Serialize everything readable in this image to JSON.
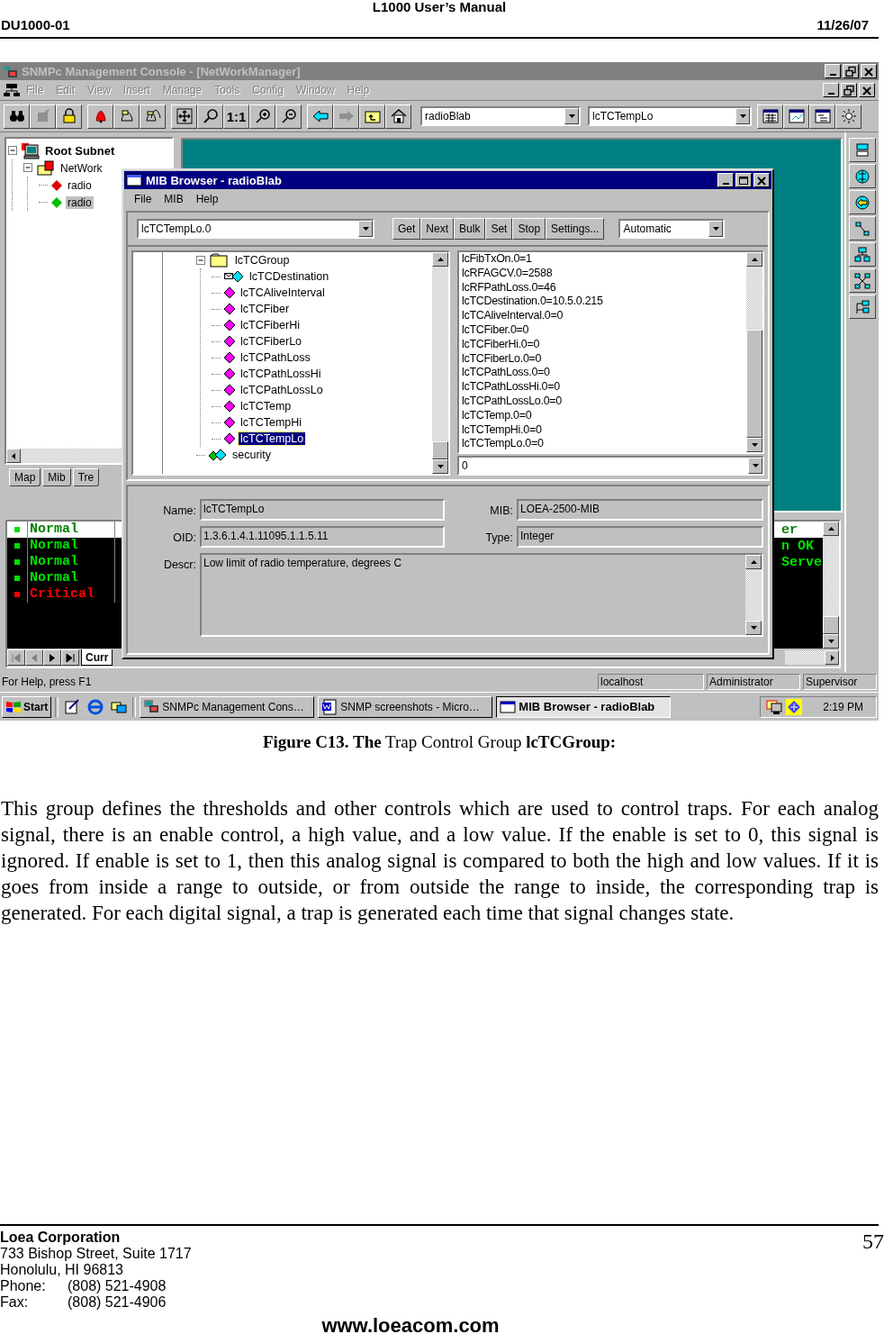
{
  "header": {
    "title": "L1000 User’s Manual",
    "doc_id": "DU1000-01",
    "date": "11/26/07"
  },
  "console": {
    "title": "SNMPc Management Console - [NetWorkManager]",
    "active": false,
    "menu": [
      "File",
      "Edit",
      "View",
      "Insert",
      "Manage",
      "Tools",
      "Config",
      "Window",
      "Help"
    ],
    "zoom_label": "1:1",
    "device": "radioBlab",
    "object": "lcTCTempLo",
    "tree": [
      {
        "label": "Root Subnet",
        "kind": "subnet",
        "expanded": true,
        "selected": false,
        "children": [
          {
            "label": "NetWork",
            "kind": "network",
            "expanded": true,
            "selected": false,
            "children": [
              {
                "label": "radio",
                "kind": "device",
                "color": "#e00000",
                "selected": false
              },
              {
                "label": "radio",
                "kind": "device",
                "color": "#00c000",
                "selected": true
              }
            ]
          }
        ]
      }
    ],
    "view_tabs": [
      "Map",
      "Mib",
      "Tre"
    ],
    "events": [
      {
        "severity": "Normal",
        "message": "er",
        "color": "#00e000",
        "selected": true
      },
      {
        "severity": "Normal",
        "message": "n OK",
        "color": "#00e000",
        "selected": false
      },
      {
        "severity": "Normal",
        "message": "Serve",
        "color": "#00e000",
        "selected": false
      },
      {
        "severity": "Normal",
        "color": "#00e000",
        "selected": false
      },
      {
        "severity": "Critical",
        "color": "#ff0000",
        "selected": false
      }
    ],
    "event_tab": "Curr",
    "status_bar": {
      "help": "For Help, press F1",
      "host": "localhost",
      "user": "Administrator",
      "role": "Supervisor"
    }
  },
  "mib_browser": {
    "title": "MIB Browser - radioBlab",
    "active": true,
    "menu": [
      "File",
      "MIB",
      "Help"
    ],
    "oid_combo": "lcTCTempLo.0",
    "buttons": [
      "Get",
      "Next",
      "Bulk",
      "Set",
      "Stop",
      "Settings..."
    ],
    "mode": "Automatic",
    "tree": [
      {
        "label": "lcTCGroup",
        "kind": "folder",
        "expanded": true,
        "selected": false,
        "children": [
          {
            "label": "lcTCDestination",
            "kind": "trap",
            "selected": false
          },
          {
            "label": "lcTCAliveInterval",
            "kind": "object",
            "selected": false
          },
          {
            "label": "lcTCFiber",
            "kind": "object",
            "selected": false
          },
          {
            "label": "lcTCFiberHi",
            "kind": "object",
            "selected": false
          },
          {
            "label": "lcTCFiberLo",
            "kind": "object",
            "selected": false
          },
          {
            "label": "lcTCPathLoss",
            "kind": "object",
            "selected": false
          },
          {
            "label": "lcTCPathLossHi",
            "kind": "object",
            "selected": false
          },
          {
            "label": "lcTCPathLossLo",
            "kind": "object",
            "selected": false
          },
          {
            "label": "lcTCTemp",
            "kind": "object",
            "selected": false
          },
          {
            "label": "lcTCTempHi",
            "kind": "object",
            "selected": false
          },
          {
            "label": "lcTCTempLo",
            "kind": "object",
            "selected": true
          }
        ]
      },
      {
        "label": "security",
        "kind": "group",
        "selected": false
      }
    ],
    "results": [
      "lcFibTxOn.0=1",
      "lcRFAGCV.0=2588",
      "lcRFPathLoss.0=46",
      "lcTCDestination.0=10.5.0.215",
      "lcTCAliveInterval.0=0",
      "lcTCFiber.0=0",
      "lcTCFiberHi.0=0",
      "lcTCFiberLo.0=0",
      "lcTCPathLoss.0=0",
      "lcTCPathLossHi.0=0",
      "lcTCPathLossLo.0=0",
      "lcTCTemp.0=0",
      "lcTCTempHi.0=0",
      "lcTCTempLo.0=0"
    ],
    "value": "0",
    "details": {
      "name_label": "Name:",
      "name": "lcTCTempLo",
      "mib_label": "MIB:",
      "mib": "LOEA-2500-MIB",
      "oid_label": "OID:",
      "oid": "1.3.6.1.4.1.11095.1.1.5.11",
      "type_label": "Type:",
      "type": "Integer",
      "descr_label": "Descr:",
      "descr": "Low limit of radio temperature, degrees C"
    }
  },
  "taskbar": {
    "start": "Start",
    "tasks": [
      {
        "label": "SNMPc Management Cons…",
        "kind": "console",
        "selected": false
      },
      {
        "label": "SNMP screenshots - Micro…",
        "kind": "document",
        "selected": false
      },
      {
        "label": "MIB Browser - radioBlab",
        "kind": "window",
        "selected": true
      }
    ],
    "clock": "2:19 PM"
  },
  "figure_caption": "**Figure C13.  The** Trap Control Group **lcTCGroup:**",
  "body_text": "This group defines the thresholds and other controls which are used to control traps. For each analog signal, there is an enable control, a high value, and a low value. If the enable is set to 0, this signal is ignored. If enable is set to 1, then this analog signal is compared to both the high and low values. If it is goes from inside a range to outside, or from outside the range to inside, the corresponding trap is generated. For each digital signal, a trap is generated each time that signal changes state.",
  "footer": {
    "company": "Loea Corporation",
    "address": "733 Bishop Street, Suite 1717",
    "city": "Honolulu, HI  96813",
    "phone_label": "Phone:",
    "phone": "(808) 521-4908",
    "fax_label": "Fax:",
    "fax": "(808) 521-4906",
    "page": "57",
    "website": "www.loeacom.com"
  }
}
